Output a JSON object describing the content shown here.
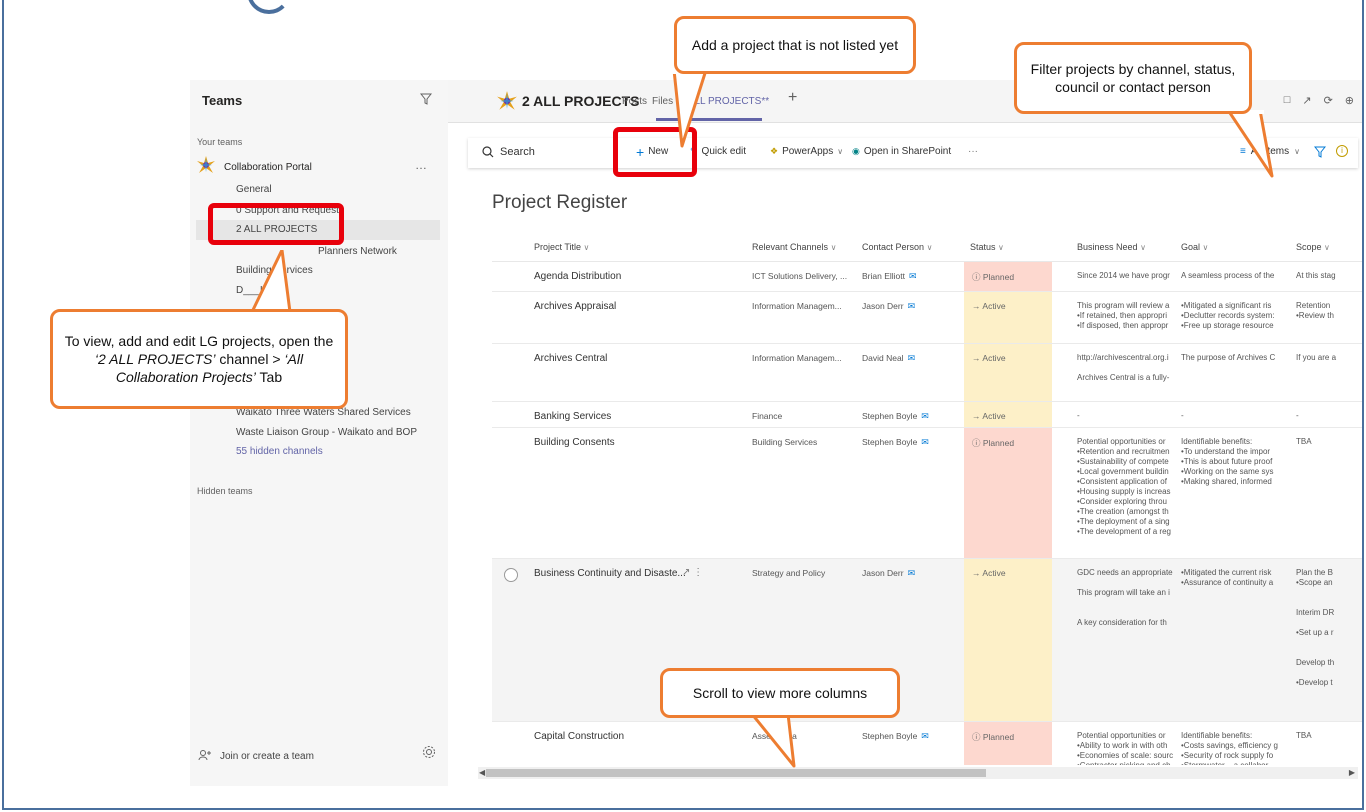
{
  "teams_pane": {
    "title": "Teams",
    "filter_icon": "filter-icon",
    "your_teams_label": "Your teams",
    "team": {
      "name": "Collaboration Portal",
      "more": "…"
    },
    "channels": [
      {
        "label": "General"
      },
      {
        "label": "0 Support and Requests"
      },
      {
        "label": "2 ALL PROJECTS"
      },
      {
        "label": "Planners Network"
      },
      {
        "label": "Building Services"
      },
      {
        "label": "D___ICT"
      },
      {
        "label": "Waikato Three Waters Shared Services"
      },
      {
        "label": "Waste Liaison Group - Waikato and BOP"
      },
      {
        "label": "55 hidden channels"
      }
    ],
    "hidden_teams_label": "Hidden teams",
    "join_label": "Join or create a team"
  },
  "tabbar": {
    "channel_title": "2 ALL PROJECTS",
    "tabs": [
      {
        "label": "Posts"
      },
      {
        "label": "Files"
      },
      {
        "label": "**ALL PROJECTS**"
      }
    ],
    "add_tab": "+"
  },
  "cmdbar": {
    "search_placeholder": "Search",
    "new_label": "New",
    "quick_edit_label": "Quick edit",
    "powerapps_label": "PowerApps",
    "open_sharepoint_label": "Open in SharePoint",
    "more": "···",
    "view_label": "All Items"
  },
  "page_title": "Project Register",
  "columns": [
    "Project Title",
    "Relevant Channels",
    "Contact Person",
    "Status",
    "Business Need",
    "Goal",
    "Scope"
  ],
  "rows": [
    {
      "title": "Agenda Distribution",
      "channels": "ICT Solutions Delivery, ...",
      "person": "Brian Elliott",
      "status": "Planned",
      "need": [
        "Since 2014 we have progr"
      ],
      "goal": [
        "A seamless process of the"
      ],
      "scope": [
        "At this stag"
      ]
    },
    {
      "title": "Archives Appraisal",
      "channels": "Information Managem...",
      "person": "Jason Derr",
      "status": "Active",
      "need": [
        "This program will review a",
        "•If retained, then appropri",
        "•If disposed, then appropr"
      ],
      "goal": [
        "•Mitigated a significant ris",
        "•Declutter records system:",
        "•Free up storage resource"
      ],
      "scope": [
        "Retention",
        "•Review th"
      ]
    },
    {
      "title": "Archives Central",
      "channels": "Information Managem...",
      "person": "David Neal",
      "status": "Active",
      "need": [
        "http://archivescentral.org.i",
        "",
        "Archives Central is a fully-"
      ],
      "goal": [
        "The purpose of Archives C"
      ],
      "scope": [
        "If you are a"
      ]
    },
    {
      "title": "Banking Services",
      "channels": "Finance",
      "person": "Stephen Boyle",
      "status": "Active",
      "need": [
        "-"
      ],
      "goal": [
        "-"
      ],
      "scope": [
        "-"
      ]
    },
    {
      "title": "Building Consents",
      "channels": "Building Services",
      "person": "Stephen Boyle",
      "status": "Planned",
      "need": [
        "Potential opportunities or",
        "•Retention and recruitmen",
        "•Sustainability of compete",
        "•Local government buildin",
        "•Consistent application of",
        "•Housing supply is increas",
        "•Consider exploring throu",
        "•The creation (amongst th",
        "•The deployment of a sing",
        "•The development of a reg"
      ],
      "goal": [
        "Identifiable benefits:",
        "•To understand the impor",
        "•This is about future proof",
        "•Working on the same sys",
        "•Making shared, informed"
      ],
      "scope": [
        "TBA"
      ]
    },
    {
      "title": "Business Continuity and Disaste...",
      "channels": "Strategy and Policy",
      "person": "Jason Derr",
      "status": "Active",
      "need": [
        "GDC needs an appropriate",
        "",
        "This program will take an i",
        "",
        "",
        "A key consideration for th"
      ],
      "goal": [
        "•Mitigated the current risk",
        "•Assurance of continuity a"
      ],
      "scope": [
        "Plan the B",
        "•Scope an",
        "",
        "",
        "Interim DR",
        "",
        "•Set up a r",
        "",
        "",
        "Develop th",
        "",
        "•Develop t"
      ]
    },
    {
      "title": "Capital Construction",
      "channels": "Asset Mana",
      "person": "Stephen Boyle",
      "status": "Planned",
      "need": [
        "Potential opportunities or",
        "•Ability to work in with oth",
        "•Economies of scale: sourc",
        "•Contractor picking and ch"
      ],
      "goal": [
        "Identifiable benefits:",
        "•Costs savings, efficiency g",
        "•Security of rock supply fo",
        "•Stormwater – a collabor"
      ],
      "scope": [
        "TBA"
      ]
    }
  ],
  "callouts": {
    "add_project": "Add a project that is not listed yet",
    "filter_projects": "Filter projects by channel, status, council or contact person",
    "view_line1": "To view, add and edit LG projects, open the",
    "view_line2_a": "‘2 ALL PROJECTS’",
    "view_line2_b": " channel > ",
    "view_line2_c": "‘All Collaboration Projects’",
    "view_line2_d": " Tab",
    "scroll": "Scroll to view more columns"
  },
  "colors": {
    "accent": "#6264a7",
    "planned": "#fdd8cf",
    "active": "#fdf0c8",
    "callout_border": "#ed7d31",
    "highlight": "#e8000b",
    "frame": "#4a6f9d"
  }
}
